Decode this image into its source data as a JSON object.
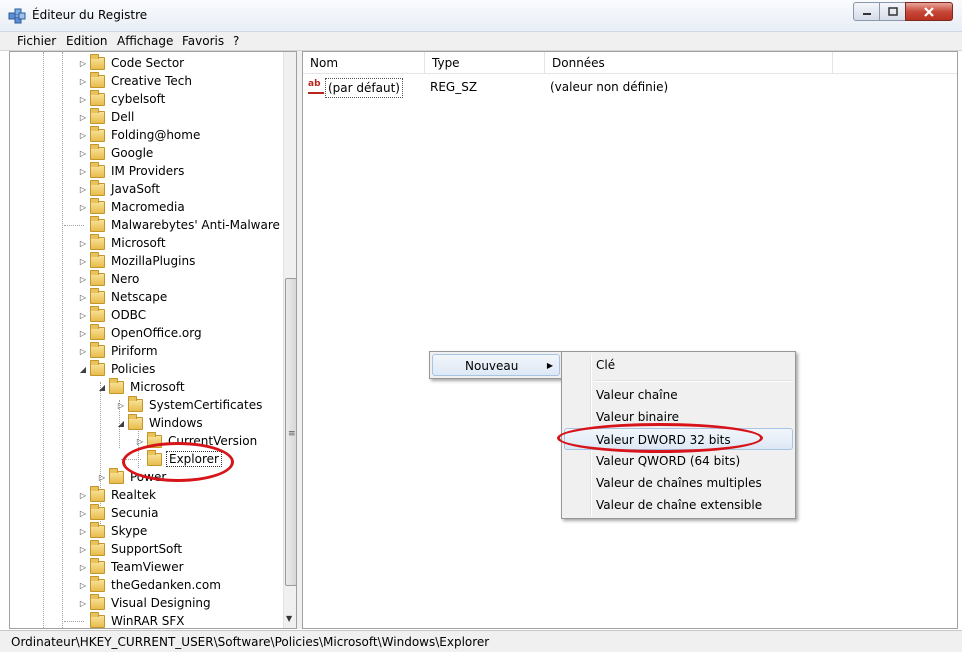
{
  "window": {
    "title": "Éditeur du Registre",
    "controls": {
      "minimize": "minimize-icon",
      "maximize": "maximize-icon",
      "close": "close-icon"
    }
  },
  "menu": [
    "Fichier",
    "Edition",
    "Affichage",
    "Favoris",
    "?"
  ],
  "tree": {
    "items": [
      {
        "label": "Code Sector",
        "expander": "▷"
      },
      {
        "label": "Creative Tech",
        "expander": "▷"
      },
      {
        "label": "cybelsoft",
        "expander": "▷"
      },
      {
        "label": "Dell",
        "expander": "▷"
      },
      {
        "label": "Folding@home",
        "expander": "▷"
      },
      {
        "label": "Google",
        "expander": "▷"
      },
      {
        "label": "IM Providers",
        "expander": "▷"
      },
      {
        "label": "JavaSoft",
        "expander": "▷"
      },
      {
        "label": "Macromedia",
        "expander": "▷"
      },
      {
        "label": "Malwarebytes' Anti-Malware",
        "expander": ""
      },
      {
        "label": "Microsoft",
        "expander": "▷"
      },
      {
        "label": "MozillaPlugins",
        "expander": "▷"
      },
      {
        "label": "Nero",
        "expander": "▷"
      },
      {
        "label": "Netscape",
        "expander": "▷"
      },
      {
        "label": "ODBC",
        "expander": "▷"
      },
      {
        "label": "OpenOffice.org",
        "expander": "▷"
      },
      {
        "label": "Piriform",
        "expander": "▷"
      },
      {
        "label": "Policies",
        "expander": "◢"
      },
      {
        "label": "Microsoft",
        "expander": "◢"
      },
      {
        "label": "SystemCertificates",
        "expander": "▷"
      },
      {
        "label": "Windows",
        "expander": "◢"
      },
      {
        "label": "CurrentVersion",
        "expander": "▷"
      },
      {
        "label": "Explorer",
        "expander": ""
      },
      {
        "label": "Power",
        "expander": "▷"
      },
      {
        "label": "Realtek",
        "expander": "▷"
      },
      {
        "label": "Secunia",
        "expander": "▷"
      },
      {
        "label": "Skype",
        "expander": "▷"
      },
      {
        "label": "SupportSoft",
        "expander": "▷"
      },
      {
        "label": "TeamViewer",
        "expander": "▷"
      },
      {
        "label": "theGedanken.com",
        "expander": "▷"
      },
      {
        "label": "Visual Designing",
        "expander": "▷"
      },
      {
        "label": "WinRAR SFX",
        "expander": ""
      }
    ]
  },
  "list": {
    "columns": [
      "Nom",
      "Type",
      "Données"
    ],
    "rows": [
      {
        "name": "(par défaut)",
        "type": "REG_SZ",
        "data": "(valeur non définie)",
        "icon": "string-value-icon"
      }
    ]
  },
  "context_menu": {
    "main_item": "Nouveau",
    "submenu": [
      "Clé",
      "Valeur chaîne",
      "Valeur binaire",
      "Valeur DWORD 32 bits",
      "Valeur QWORD (64 bits)",
      "Valeur de chaînes multiples",
      "Valeur de chaîne extensible"
    ],
    "highlighted": "Valeur DWORD 32 bits"
  },
  "status_bar": "Ordinateur\\HKEY_CURRENT_USER\\Software\\Policies\\Microsoft\\Windows\\Explorer",
  "colors": {
    "annotation": "#d6141a",
    "highlight": "#dde8f5"
  }
}
